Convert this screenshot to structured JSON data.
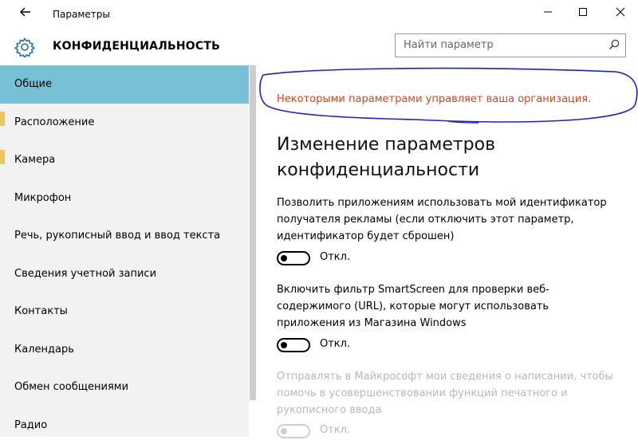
{
  "titlebar": {
    "back_icon": "back-arrow-icon",
    "title": "Параметры",
    "minimize": "—",
    "maximize": "☐",
    "close": "✕"
  },
  "header": {
    "section_icon": "gear-icon",
    "section_title": "КОНФИДЕНЦИАЛЬНОСТЬ",
    "search_placeholder": "Найти параметр",
    "search_icon": "search-icon"
  },
  "sidebar": {
    "items": [
      {
        "label": "Общие",
        "active": true
      },
      {
        "label": "Расположение"
      },
      {
        "label": "Камера"
      },
      {
        "label": "Микрофон"
      },
      {
        "label": "Речь, рукописный ввод и ввод текста"
      },
      {
        "label": "Сведения учетной записи"
      },
      {
        "label": "Контакты"
      },
      {
        "label": "Календарь"
      },
      {
        "label": "Обмен сообщениями"
      },
      {
        "label": "Радио"
      }
    ]
  },
  "main": {
    "notice": "Некоторыми параметрами управляет ваша организация.",
    "heading_line1": "Изменение параметров",
    "heading_line2": "конфиденциальности",
    "options": [
      {
        "description": "Позволить приложениям использовать мой идентификатор получателя рекламы (если отключить этот параметр, идентификатор будет сброшен)",
        "state": "Откл.",
        "enabled": true
      },
      {
        "description": "Включить фильтр SmartScreen для проверки веб-содержимого (URL), которые могут использовать приложения из Магазина Windows",
        "state": "Откл.",
        "enabled": true
      },
      {
        "description": "Отправлять в Майкрософт мои сведения о написании, чтобы помочь в усовершенствовании функций печатного и рукописного ввода",
        "state": "Откл.",
        "enabled": false
      }
    ]
  },
  "colors": {
    "accent_nav": "#77c0d6",
    "notice_text": "#e4400f",
    "annotation_ink": "#1a1fd6"
  }
}
